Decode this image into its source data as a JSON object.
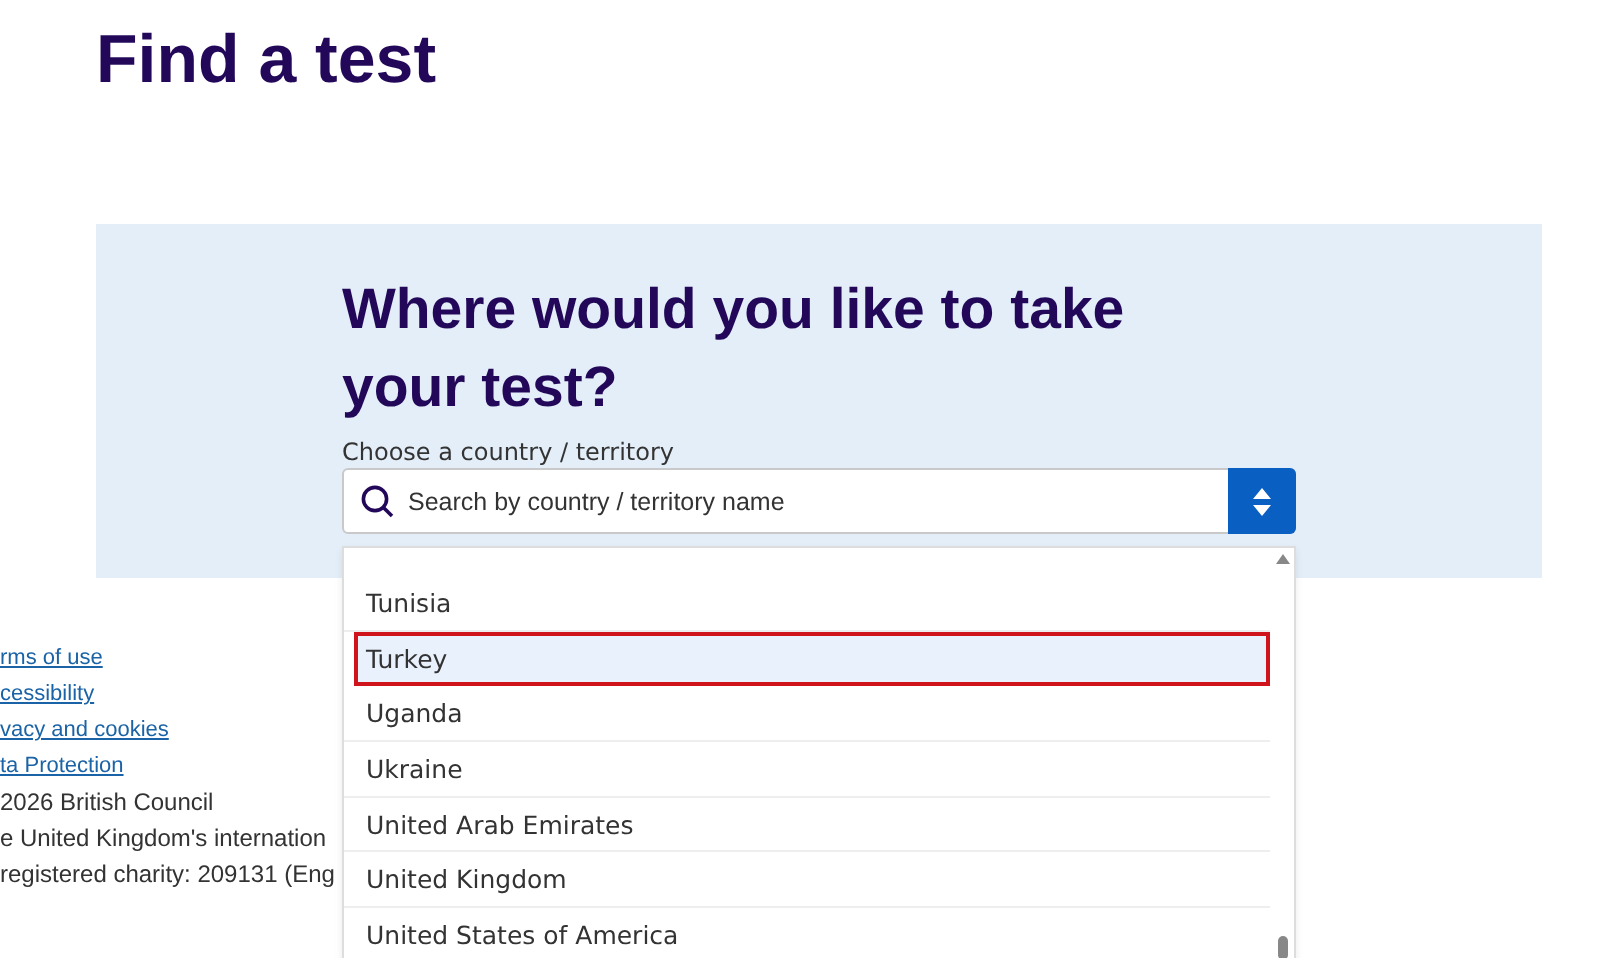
{
  "page_title": "Find a test",
  "search_panel": {
    "heading": "Where would you like to take your test?",
    "label": "Choose a country / territory",
    "search": {
      "placeholder": "Search by country / territory name"
    },
    "options": [
      {
        "label": "Tunisia",
        "selected": false
      },
      {
        "label": "Turkey",
        "selected": true
      },
      {
        "label": "Uganda",
        "selected": false
      },
      {
        "label": "Ukraine",
        "selected": false
      },
      {
        "label": "United Arab Emirates",
        "selected": false
      },
      {
        "label": "United Kingdom",
        "selected": false
      },
      {
        "label": "United States of America",
        "selected": false
      }
    ]
  },
  "footer": {
    "links": [
      "rms of use",
      "cessibility",
      "vacy and cookies",
      "ta Protection"
    ],
    "lines": [
      "2026 British Council",
      "e United Kingdom's internation",
      "registered charity: 209131 (Eng"
    ]
  }
}
